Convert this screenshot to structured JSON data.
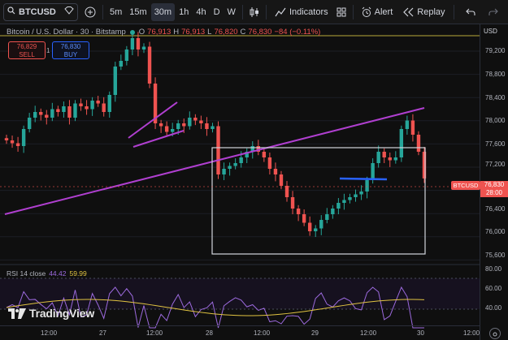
{
  "toolbar": {
    "symbol": "BTCUSD",
    "intervals": [
      "5m",
      "15m",
      "30m",
      "1h",
      "4h",
      "D",
      "W"
    ],
    "active_interval": "30m",
    "indicators_label": "Indicators",
    "alert_label": "Alert",
    "replay_label": "Replay"
  },
  "legend": {
    "title": "Bitcoin / U.S. Dollar · 30 · Bitstamp",
    "o_label": "O",
    "o": "76,913",
    "h_label": "H",
    "h": "76,913",
    "l_label": "L",
    "l": "76,820",
    "c_label": "C",
    "c": "76,830",
    "change": "−84 (−0.11%)"
  },
  "trade": {
    "sell_price": "76,829",
    "sell_label": "SELL",
    "spread": "1",
    "buy_price": "76,830",
    "buy_label": "BUY"
  },
  "price_axis": {
    "currency": "USD",
    "ticks": [
      "79,200",
      "78,800",
      "78,400",
      "78,000",
      "77,600",
      "77,200",
      "76,400",
      "76,000",
      "75,600"
    ],
    "symbol_tag": "BTCUSD",
    "last_price": "76,830",
    "countdown": "28:00",
    "rsi_ticks": [
      "80.00",
      "60.00",
      "40.00"
    ]
  },
  "rsi": {
    "label": "RSI 14 close",
    "value1": "44.42",
    "value2": "59.99"
  },
  "logo": {
    "name": "TradingView"
  },
  "time_axis": {
    "ticks": [
      "12:00",
      "27",
      "12:00",
      "28",
      "12:00",
      "29",
      "12:00",
      "30",
      "12:00"
    ]
  },
  "colors": {
    "up": "#26a69a",
    "down": "#ef5350",
    "trendline": "#b03fd0",
    "hline": "#2962ff",
    "box": "#d1d4dc",
    "rsi_line": "#9c6ade",
    "rsi_ma": "#e0c341",
    "price_tag": "#ef5350"
  },
  "chart_data": {
    "type": "candlestick",
    "y_range": [
      75400,
      79400
    ],
    "closes": [
      77500,
      77450,
      77400,
      77700,
      77900,
      78000,
      77950,
      77900,
      78050,
      78000,
      78100,
      77900,
      78150,
      78100,
      78050,
      78200,
      78150,
      78000,
      78300,
      78800,
      78900,
      79100,
      79300,
      79100,
      79150,
      78500,
      77800,
      77750,
      77650,
      77700,
      77800,
      77750,
      77900,
      77850,
      77800,
      77700,
      77750,
      76900,
      77000,
      77050,
      77100,
      77200,
      77300,
      77400,
      77300,
      77200,
      77000,
      76900,
      76700,
      76500,
      76300,
      76200,
      76050,
      75900,
      75950,
      76100,
      76200,
      76300,
      76400,
      76450,
      76500,
      76550,
      76600,
      76800,
      77100,
      77300,
      77200,
      77150,
      77200,
      77700,
      77850,
      77600,
      77300,
      76830
    ]
  }
}
